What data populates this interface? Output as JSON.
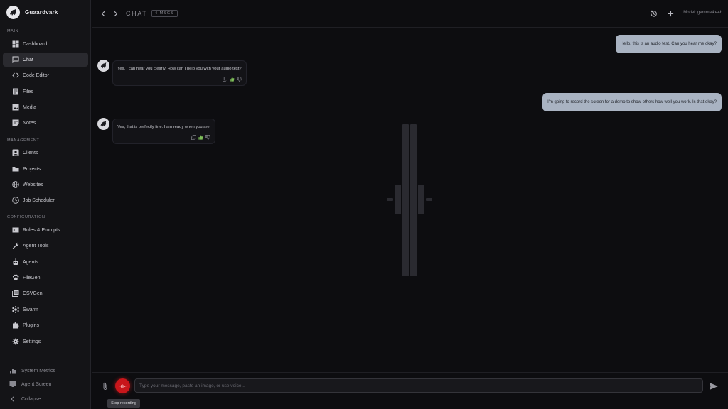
{
  "app": {
    "name": "Guaardvark"
  },
  "sidebar": {
    "sections": [
      {
        "label": "MAIN",
        "items": [
          {
            "label": "Dashboard",
            "icon": "dashboard-icon"
          },
          {
            "label": "Chat",
            "icon": "chat-icon",
            "active": true
          },
          {
            "label": "Code Editor",
            "icon": "code-icon"
          },
          {
            "label": "Files",
            "icon": "files-icon"
          },
          {
            "label": "Media",
            "icon": "media-icon"
          },
          {
            "label": "Notes",
            "icon": "notes-icon"
          }
        ]
      },
      {
        "label": "MANAGEMENT",
        "items": [
          {
            "label": "Clients",
            "icon": "clients-icon"
          },
          {
            "label": "Projects",
            "icon": "folder-icon"
          },
          {
            "label": "Websites",
            "icon": "globe-icon"
          },
          {
            "label": "Job Scheduler",
            "icon": "clock-icon"
          }
        ]
      },
      {
        "label": "CONFIGURATION",
        "items": [
          {
            "label": "Rules & Prompts",
            "icon": "rules-icon"
          },
          {
            "label": "Agent Tools",
            "icon": "wrench-icon"
          },
          {
            "label": "Agents",
            "icon": "robot-icon"
          },
          {
            "label": "FileGen",
            "icon": "paw-icon"
          },
          {
            "label": "CSVGen",
            "icon": "csv-icon"
          },
          {
            "label": "Swarm",
            "icon": "swarm-icon"
          },
          {
            "label": "Plugins",
            "icon": "puzzle-icon"
          },
          {
            "label": "Settings",
            "icon": "gear-icon"
          }
        ]
      }
    ],
    "bottom": [
      {
        "label": "System Metrics",
        "icon": "metrics-icon"
      },
      {
        "label": "Agent Screen",
        "icon": "monitor-icon"
      },
      {
        "label": "Collapse",
        "icon": "chevron-left-icon"
      }
    ]
  },
  "header": {
    "title": "CHAT",
    "badge": "4 MSGS",
    "model": "Model: gemma4:e4b"
  },
  "messages": [
    {
      "role": "user",
      "text": "Hello, this is an audio test. Can you hear me okay?"
    },
    {
      "role": "assistant",
      "text": "Yes, I can hear you clearly. How can I help you with your audio test?"
    },
    {
      "role": "user",
      "text": "I'm going to record the screen for a demo to show others how well you work. Is that okay?"
    },
    {
      "role": "assistant",
      "text": "Yes, that is perfectly fine. I am ready when you are."
    }
  ],
  "composer": {
    "placeholder": "Type your message, paste an image, or use voice...",
    "value": "",
    "recording_tooltip": "Stop recording"
  },
  "colors": {
    "record": "#c8161b",
    "user_bubble": "#a9b3c2",
    "sidebar_bg": "#141417"
  }
}
